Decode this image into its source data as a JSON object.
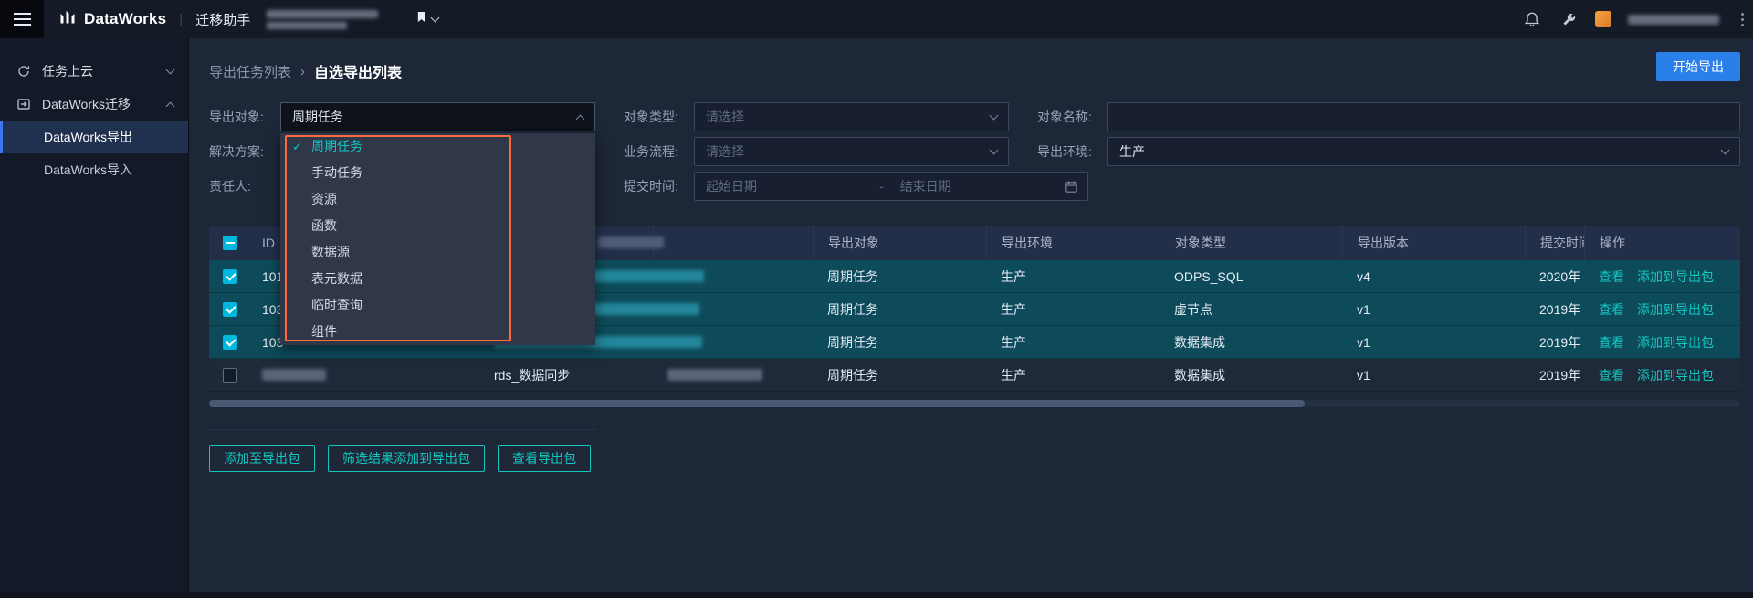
{
  "topbar": {
    "product": "DataWorks",
    "divider": "|",
    "app": "迁移助手"
  },
  "sidebar": {
    "item_task_cloud": "任务上云",
    "item_dw_migration": "DataWorks迁移",
    "item_dw_export": "DataWorks导出",
    "item_dw_import": "DataWorks导入"
  },
  "breadcrumb": {
    "parent": "导出任务列表",
    "separator": "›",
    "current": "自选导出列表"
  },
  "header_actions": {
    "start_export": "开始导出"
  },
  "filters": {
    "export_object_label": "导出对象:",
    "export_object_value": "周期任务",
    "object_type_label": "对象类型:",
    "object_type_placeholder": "请选择",
    "object_name_label": "对象名称:",
    "solution_label": "解决方案:",
    "business_flow_label": "业务流程:",
    "business_flow_placeholder": "请选择",
    "export_env_label": "导出环境:",
    "export_env_value": "生产",
    "owner_label": "责任人:",
    "submit_time_label": "提交时间:",
    "date_start_placeholder": "起始日期",
    "date_separator": "-",
    "date_end_placeholder": "结束日期"
  },
  "dropdown": {
    "check_glyph": "✓",
    "selected": "周期任务",
    "options": [
      "周期任务",
      "手动任务",
      "资源",
      "函数",
      "数据源",
      "表元数据",
      "临时查询",
      "组件"
    ],
    "highlight_color": "#FF6A3C"
  },
  "table": {
    "headers": {
      "id": "ID",
      "export_object": "导出对象",
      "export_env": "导出环境",
      "object_type": "对象类型",
      "export_version": "导出版本",
      "submit_time": "提交时间",
      "operation": "操作"
    },
    "row_actions": {
      "view": "查看",
      "add_to_package": "添加到导出包"
    },
    "rows": [
      {
        "checked": true,
        "selected": true,
        "id": "101",
        "name": "",
        "export_object": "周期任务",
        "export_env": "生产",
        "object_type": "ODPS_SQL",
        "export_version": "v4",
        "submit_time": "2020年"
      },
      {
        "checked": true,
        "selected": true,
        "id": "103",
        "name": "",
        "export_object": "周期任务",
        "export_env": "生产",
        "object_type": "虚节点",
        "export_version": "v1",
        "submit_time": "2019年"
      },
      {
        "checked": true,
        "selected": true,
        "id": "103",
        "name": "",
        "export_object": "周期任务",
        "export_env": "生产",
        "object_type": "数据集成",
        "export_version": "v1",
        "submit_time": "2019年"
      },
      {
        "checked": false,
        "selected": false,
        "id": "",
        "name": "rds_数据同步",
        "export_object": "周期任务",
        "export_env": "生产",
        "object_type": "数据集成",
        "export_version": "v1",
        "submit_time": "2019年"
      }
    ]
  },
  "footer": {
    "add_to_package": "添加至导出包",
    "add_filtered_to_package": "筛选结果添加到导出包",
    "view_package": "查看导出包"
  },
  "colors": {
    "accent_teal": "#12C8C1",
    "accent_blue": "#2A7FE8",
    "checkbox": "#00B7DD",
    "selected_row": "#0E4B5A",
    "highlight_orange": "#FF6A3C"
  }
}
